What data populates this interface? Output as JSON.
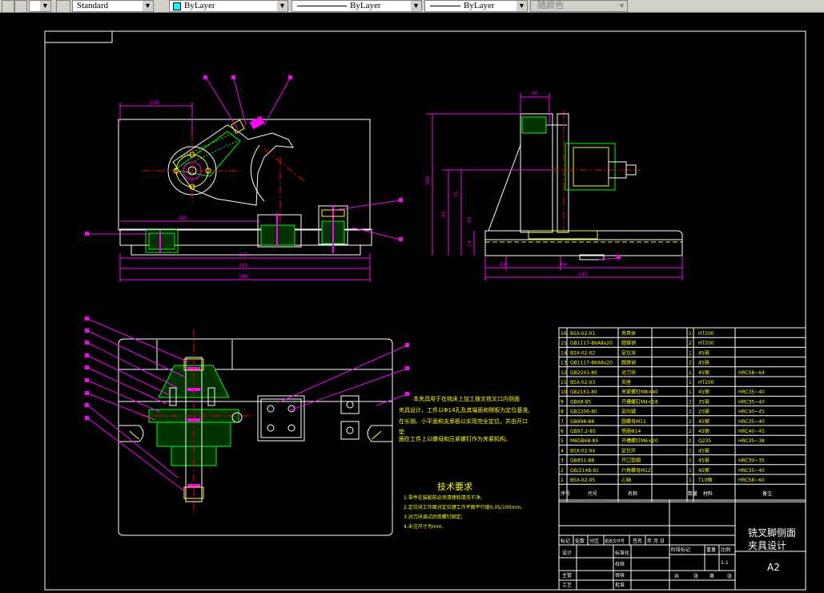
{
  "toolbar": {
    "text_style": "Standard",
    "color_control": "ByLayer",
    "linetype_control": "ByLayer",
    "lineweight_control": "ByLayer",
    "plotstyle_control": "随颜色",
    "colors": {
      "color_swatch": "#00ffff"
    }
  },
  "drawing": {
    "background": "#000000",
    "technical_requirements_title": "技术要求",
    "technical_requirements": [
      "1.零件在装配前必须清理和清洗干净;",
      "2.定位块工作面对定位键工作平面平行度0.05/100mm;",
      "3.对刀块调试后用螺钉固定;",
      "4.未注尺寸为mm."
    ],
    "description_lines": [
      "本夹具用于在铣床上加工拨叉铣叉口内侧面",
      "夹具设计，工件以Φ14孔及其端面和侧板为定位基准,",
      "在长销、小平面和支承板以实现完全定位，并由开口",
      "垫",
      "圈在工件上以螺母和压紧螺钉作为夹紧机构。"
    ],
    "dimensions": {
      "d100": "100",
      "d20": "20",
      "d195": "195",
      "d125": "125",
      "d165": "165",
      "d188": "188",
      "d24": "24",
      "d84": "84",
      "d145": "145",
      "v160": "160",
      "v95": "95",
      "v75": "75",
      "v55": "55",
      "v14": "14"
    },
    "bom": {
      "rows": [
        {
          "no": "16",
          "code": "BSX-02-01",
          "name": "夹具体",
          "qty": "1",
          "material": "HT200",
          "note": ""
        },
        {
          "no": "15",
          "code": "GB1117-86A8x20",
          "name": "圆锥销",
          "qty": "2",
          "material": "HT200",
          "note": ""
        },
        {
          "no": "14",
          "code": "BSX-02-02",
          "name": "定位块",
          "qty": "1",
          "material": "45钢",
          "note": ""
        },
        {
          "no": "13",
          "code": "GB1117-86A8x20",
          "name": "圆锥销",
          "qty": "2",
          "material": "45钢",
          "note": ""
        },
        {
          "no": "12",
          "code": "GB2241-80",
          "name": "对刀块",
          "qty": "1",
          "material": "45钢",
          "note": "HRC58~64"
        },
        {
          "no": "11",
          "code": "BSX-02-03",
          "name": "支座",
          "qty": "1",
          "material": "HT200",
          "note": ""
        },
        {
          "no": "10",
          "code": "GB2161-80",
          "name": "夹紧螺钉M8×40",
          "qty": "1",
          "material": "45钢",
          "note": "HRC35~40"
        },
        {
          "no": "9",
          "code": "GB68-85",
          "name": "开槽螺钉M4×18",
          "qty": "2",
          "material": "35钢",
          "note": "HRC35~40"
        },
        {
          "no": "8",
          "code": "GB2206-80",
          "name": "定向键",
          "qty": "2",
          "material": "20钢",
          "note": "HRC40~45"
        },
        {
          "no": "7",
          "code": "GB898-88",
          "name": "圆螺母M12",
          "qty": "2",
          "material": "45钢",
          "note": "HRC35~40"
        },
        {
          "no": "6",
          "code": "GB97.2-85",
          "name": "垫圈Φ14",
          "qty": "2",
          "material": "45钢",
          "note": "HRC40~45"
        },
        {
          "no": "5",
          "code": "M6GB68-85",
          "name": "开槽螺钉M6×20",
          "qty": "2",
          "material": "Q235",
          "note": "HRC35~38"
        },
        {
          "no": "4",
          "code": "BSX-02-04",
          "name": "定位环",
          "qty": "1",
          "material": "45钢",
          "note": ""
        },
        {
          "no": "3",
          "code": "GB851-88",
          "name": "开口垫圈",
          "qty": "1",
          "material": "45钢",
          "note": "HRC30~35"
        },
        {
          "no": "2",
          "code": "GB/2148-91",
          "name": "六角螺母M12",
          "qty": "1",
          "material": "45钢",
          "note": "HRC35~40"
        },
        {
          "no": "1",
          "code": "BSX-02-05",
          "name": "心轴",
          "qty": "1",
          "material": "T10钢",
          "note": "HRC58~60"
        }
      ],
      "headers": {
        "no": "序号",
        "code": "代号",
        "name": "名称",
        "qty": "数量",
        "material": "材料",
        "note": "备注"
      }
    },
    "title_block": {
      "title_line1": "铣叉脚侧面",
      "title_line2": "夹具设计",
      "sheet_size": "A2",
      "labels": {
        "mark": "标记",
        "count": "处数",
        "zone": "分区",
        "doc_no": "更改文件号",
        "sign": "签名",
        "date": "年 月 日",
        "design": "设计",
        "standardize": "标准化",
        "check": "审核",
        "process": "工艺",
        "approve": "批准",
        "stage": "阶段标记",
        "weight": "重量",
        "scale": "比例",
        "scale_value": "1:1",
        "sheet_total": "共",
        "sheets": "张",
        "sheet_no": "第",
        "sheet": "张",
        "proofread": "校核",
        "principal": "主管"
      }
    }
  }
}
